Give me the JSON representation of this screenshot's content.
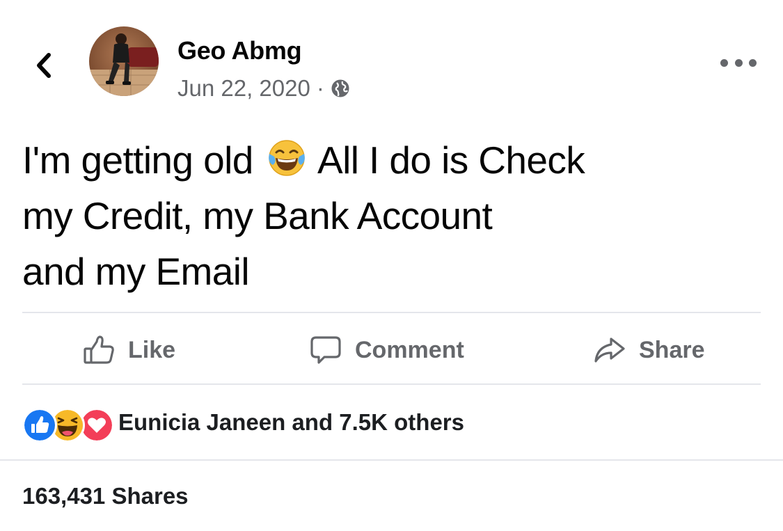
{
  "header": {
    "author_name": "Geo Abmg",
    "date": "Jun 22, 2020",
    "separator": "·",
    "privacy_icon": "globe-icon",
    "back_icon": "chevron-left-icon",
    "more_icon": "more-options-icon"
  },
  "post": {
    "text_line1_a": "I'm getting old",
    "emoji": "face-with-tears-of-joy",
    "text_line1_b": "All I do is Check",
    "text_line2": "my Credit, my Bank Account",
    "text_line3": "and my Email"
  },
  "actions": {
    "like_label": "Like",
    "comment_label": "Comment",
    "share_label": "Share",
    "like_icon": "thumbs-up-outline-icon",
    "comment_icon": "comment-bubble-icon",
    "share_icon": "share-arrow-icon"
  },
  "reactions": {
    "icons": [
      "like-reaction-icon",
      "haha-reaction-icon",
      "love-reaction-icon"
    ],
    "summary": "Eunicia Janeen and 7.5K others"
  },
  "shares": {
    "label": "163,431 Shares"
  },
  "colors": {
    "text_primary": "#050505",
    "text_secondary": "#65676b",
    "divider": "#e4e6eb",
    "like_blue": "#1877f2",
    "love_red": "#f33e58",
    "haha_yellow": "#f7b928"
  }
}
